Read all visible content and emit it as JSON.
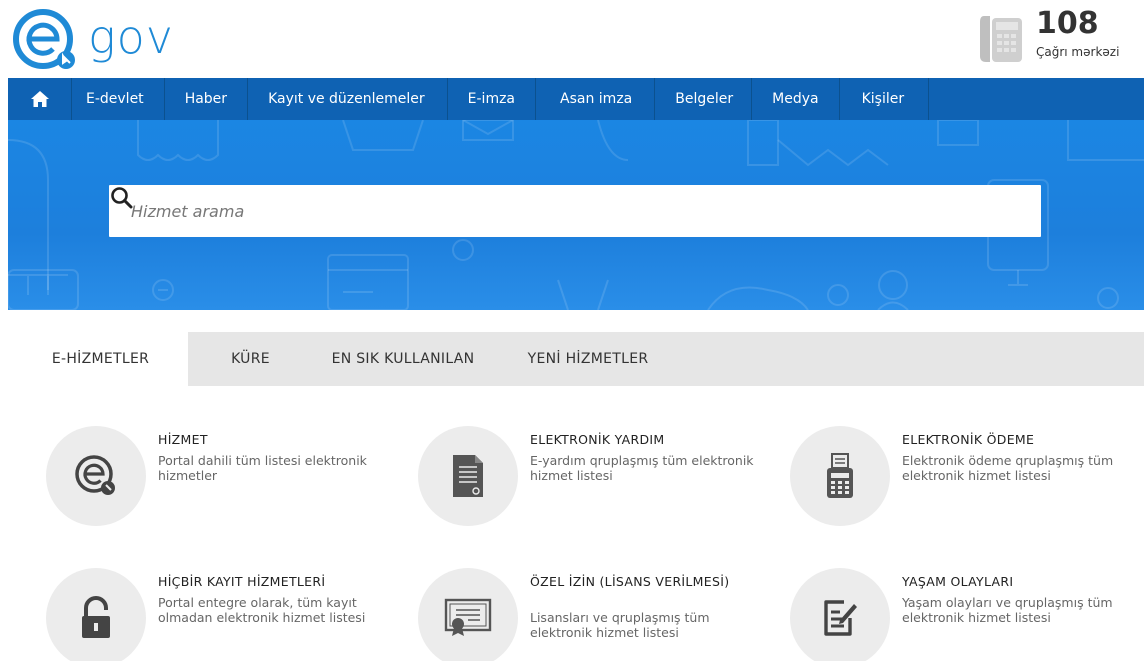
{
  "header": {
    "logo_text": "gov",
    "call_number": "108",
    "call_label": "Çağrı mərkəzi"
  },
  "nav": {
    "items": [
      {
        "label": "E-devlet"
      },
      {
        "label": "Haber"
      },
      {
        "label": "Kayıt ve düzenlemeler"
      },
      {
        "label": "E-imza"
      },
      {
        "label": "Asan imza"
      },
      {
        "label": "Belgeler"
      },
      {
        "label": "Medya"
      },
      {
        "label": "Kişiler"
      }
    ]
  },
  "search": {
    "placeholder": "Hizmet arama"
  },
  "tabs": [
    {
      "label": "E-HİZMETLER",
      "active": true
    },
    {
      "label": "KÜRE",
      "active": false
    },
    {
      "label": "EN SIK KULLANILAN",
      "active": false
    },
    {
      "label": "YENİ HİZMETLER",
      "active": false
    }
  ],
  "services": [
    {
      "title": "HİZMET",
      "desc": "Portal dahili tüm listesi elektronik hizmetler",
      "icon": "egov-logo-icon"
    },
    {
      "title": "ELEKTRONİK YARDIM",
      "desc": "E-yardım qruplaşmış tüm elektronik hizmet listesi",
      "icon": "document-icon"
    },
    {
      "title": "ELEKTRONİK ÖDEME",
      "desc": "Elektronik ödeme qruplaşmış tüm elektronik hizmet listesi",
      "icon": "payment-terminal-icon"
    },
    {
      "title": "HİÇBİR KAYIT HİZMETLERİ",
      "desc": "Portal entegre olarak, tüm kayıt olmadan elektronik hizmet listesi",
      "icon": "unlock-icon"
    },
    {
      "title": "ÖZEL İZİN (LİSANS VERİLMESİ)",
      "desc": "Lisansları ve qruplaşmış tüm elektronik hizmet listesi",
      "icon": "certificate-icon"
    },
    {
      "title": "YAŞAM OLAYLARI",
      "desc": "Yaşam olayları ve qruplaşmış tüm elektronik hizmet listesi",
      "icon": "edit-note-icon"
    }
  ],
  "colors": {
    "nav_bg": "#0f62b3",
    "hero_bg": "#1b86e3",
    "brand": "#1f8ad6",
    "tab_bg": "#e6e6e6",
    "icon_circle": "#ececec"
  }
}
